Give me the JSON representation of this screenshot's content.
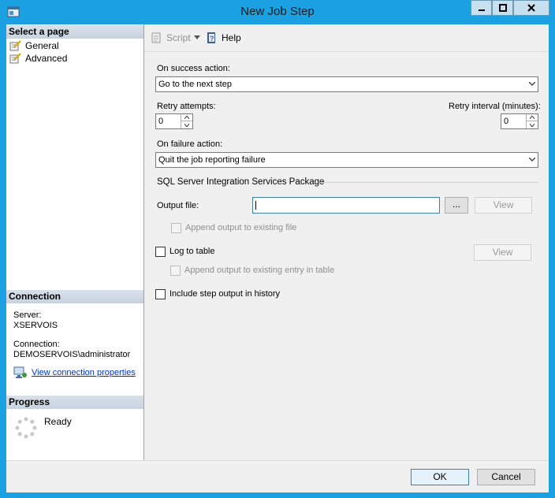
{
  "window": {
    "title": "New Job Step"
  },
  "left": {
    "select_page_header": "Select a page",
    "pages": [
      {
        "label": "General"
      },
      {
        "label": "Advanced"
      }
    ],
    "connection_header": "Connection",
    "server_label": "Server:",
    "server_value": "XSERVOIS",
    "connection_label": "Connection:",
    "connection_value": "DEMOSERVOIS\\administrator",
    "view_connection_link": "View connection properties",
    "progress_header": "Progress",
    "progress_status": "Ready"
  },
  "toolbar": {
    "script_label": "Script",
    "help_label": "Help"
  },
  "form": {
    "on_success_label": "On success action:",
    "on_success_value": "Go to the next step",
    "retry_attempts_label": "Retry attempts:",
    "retry_attempts_value": "0",
    "retry_interval_label": "Retry interval (minutes):",
    "retry_interval_value": "0",
    "on_failure_label": "On failure action:",
    "on_failure_value": "Quit the job reporting failure",
    "ssis_group_label": "SQL Server Integration Services Package",
    "output_file_label": "Output file:",
    "output_file_value": "",
    "browse_label": "...",
    "view_label": "View",
    "append_output_label": "Append output to existing file",
    "log_to_table_label": "Log to table",
    "view_table_label": "View",
    "append_entry_label": "Append output to existing entry in table",
    "include_history_label": "Include step output in history"
  },
  "footer": {
    "ok_label": "OK",
    "cancel_label": "Cancel"
  },
  "colors": {
    "window_frame": "#1ba1e2",
    "link": "#0033cc"
  }
}
